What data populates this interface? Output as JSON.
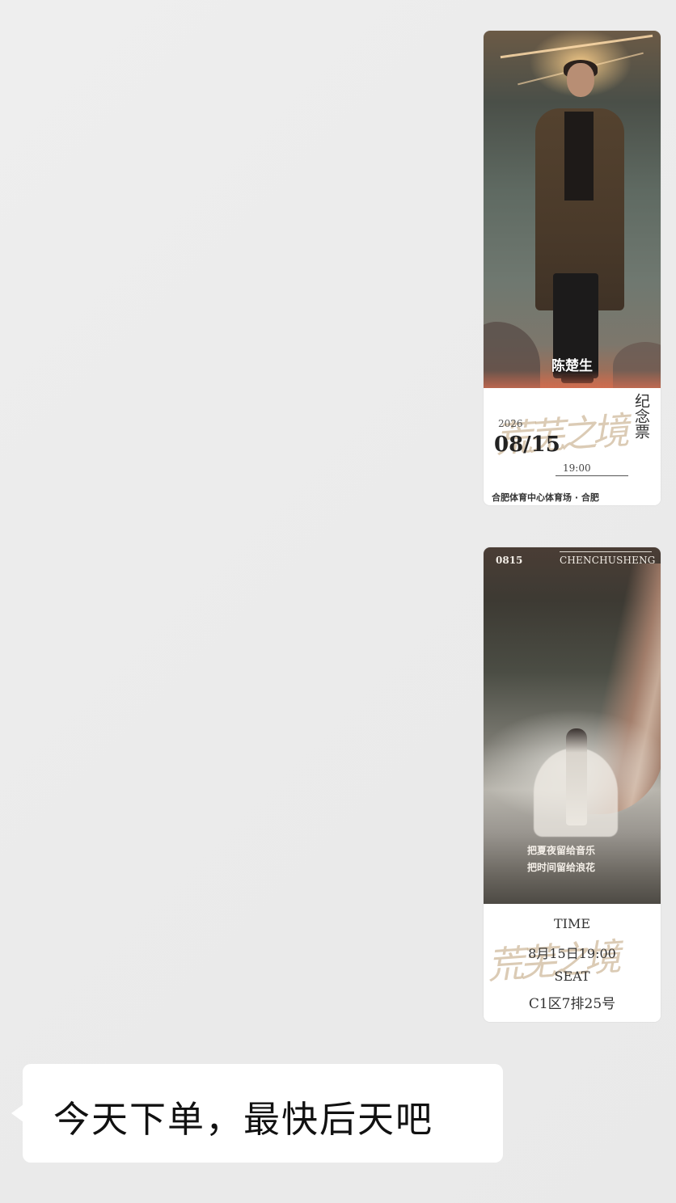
{
  "messages": [
    {
      "type": "image",
      "direction": "outgoing",
      "ticket": {
        "name": "陈楚生",
        "stub_vertical": "纪念票",
        "year": "2026",
        "date": "08/15",
        "time": "19:00",
        "venue": "合肥体育中心体育场 · 合肥"
      }
    },
    {
      "type": "image",
      "direction": "outgoing",
      "ticket": {
        "top_left": "0815",
        "top_right": "CHENCHUSHENG",
        "line1": "把夏夜留给音乐",
        "line2": "把时间留给浪花",
        "time_label": "TIME",
        "time_value": "8月15日19:00",
        "seat_label": "SEAT",
        "seat_value": "C1区7排25号"
      }
    },
    {
      "type": "text",
      "direction": "incoming",
      "text": "今天下单，最快后天吧"
    }
  ],
  "colors": {
    "chat_background": "#ededed",
    "bubble_incoming": "#ffffff",
    "bubble_text": "#111111"
  }
}
